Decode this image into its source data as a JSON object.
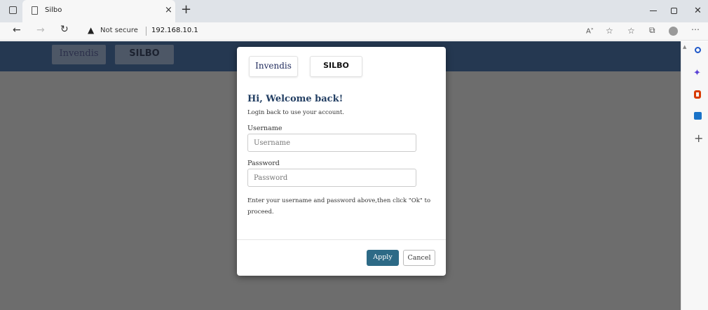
{
  "browser": {
    "tab_title": "Silbo",
    "tab_close": "×",
    "new_tab": "+",
    "not_secure": "Not secure",
    "url": "192.168.10.1"
  },
  "header": {
    "logo_invendis": "Invendis",
    "logo_silbo": "SILBO"
  },
  "modal": {
    "title": "Hi, Welcome back!",
    "subtitle": "Login back to use your account.",
    "username_label": "Username",
    "username_placeholder": "Username",
    "password_label": "Password",
    "password_placeholder": "Password",
    "help_text": "Enter your username and password above,then click \"Ok\" to proceed.",
    "apply_label": "Apply",
    "cancel_label": "Cancel"
  },
  "colors": {
    "nav": "#253851",
    "overlay": "#6d6d6d",
    "accent": "#2d6a86"
  }
}
